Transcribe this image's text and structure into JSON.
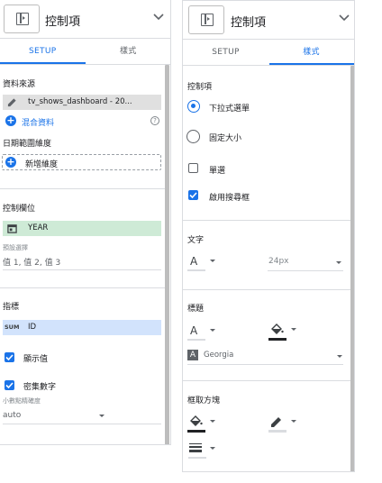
{
  "left": {
    "header": {
      "title": "控制項"
    },
    "tabs": {
      "setup": "SETUP",
      "style": "樣式"
    },
    "data_source": {
      "title": "資料來源",
      "source_name": "tv_shows_dashboard - 20...",
      "blend_label": "混合資料",
      "help_glyph": "?"
    },
    "date_range": {
      "title": "日期範圍維度",
      "add_label": "新增維度"
    },
    "control_field": {
      "title": "控制欄位",
      "field": "YEAR",
      "default_label": "預設選擇",
      "default_value": "值 1, 值 2, 值 3"
    },
    "metric": {
      "title": "指標",
      "sum_badge": "SUM",
      "field": "ID",
      "show_values": "顯示值",
      "compact_numbers": "密集數字",
      "decimal_label": "小數點精確度",
      "decimal_value": "auto"
    }
  },
  "right": {
    "header": {
      "title": "控制項"
    },
    "tabs": {
      "setup": "SETUP",
      "style": "樣式"
    },
    "control_section": {
      "title": "控制項",
      "dropdown_option": "下拉式選單",
      "fixed_size_option": "固定大小",
      "single_select": "單選",
      "enable_search": "啟用搜尋框"
    },
    "text_section": {
      "title": "文字",
      "font_size": "24px",
      "font_letter": "A"
    },
    "label_section": {
      "title": "標題",
      "font_name": "Georgia",
      "font_letter": "A"
    },
    "border_section": {
      "title": "框取方塊"
    }
  },
  "colors": {
    "accent": "#1a73e8",
    "field_green": "#ceead6",
    "metric_blue": "#d2e3fc",
    "source_gray": "#e0e0e0"
  }
}
